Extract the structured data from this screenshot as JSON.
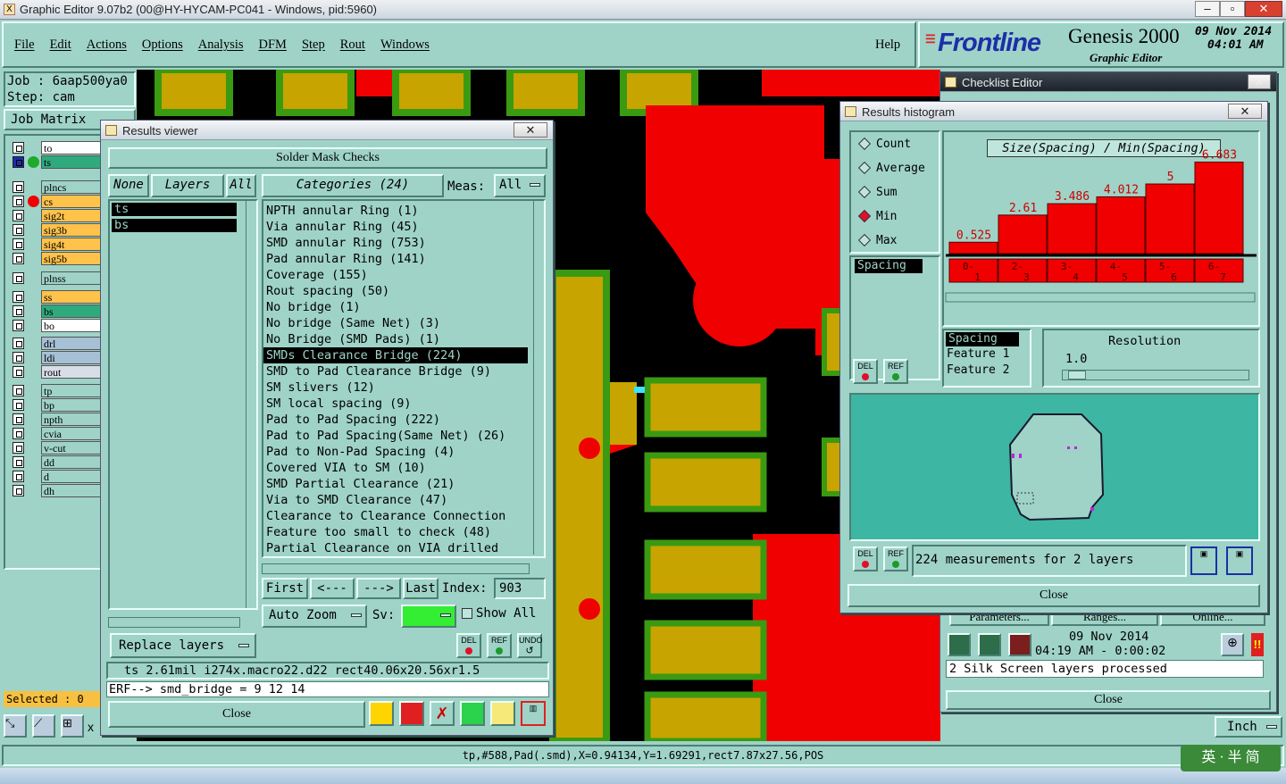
{
  "title_bar": {
    "text": "Graphic Editor 9.07b2 (00@HY-HYCAM-PC041 - Windows, pid:5960)"
  },
  "menu": {
    "items": [
      "File",
      "Edit",
      "Actions",
      "Options",
      "Analysis",
      "DFM",
      "Step",
      "Rout",
      "Windows"
    ],
    "help": "Help"
  },
  "brand": {
    "logo": "Frontline",
    "product": "Genesis 2000",
    "subtitle": "Graphic Editor",
    "date": "09 Nov 2014",
    "time": "04:01 AM"
  },
  "job": {
    "job_line": "Job : 6aap500ya0",
    "step_line": "Step: cam",
    "matrix_label": "Job Matrix"
  },
  "layers": [
    {
      "name": "to",
      "color": "#ffffff",
      "dot": ""
    },
    {
      "name": "ts",
      "color": "#2faa7d",
      "dot": "#1faa2a"
    },
    {
      "name": "plncs",
      "color": "#9fd3c7",
      "dot": ""
    },
    {
      "name": "cs",
      "color": "#ffc24a",
      "dot": "#f00000"
    },
    {
      "name": "sig2t",
      "color": "#ffc24a",
      "dot": ""
    },
    {
      "name": "sig3b",
      "color": "#ffc24a",
      "dot": ""
    },
    {
      "name": "sig4t",
      "color": "#ffc24a",
      "dot": ""
    },
    {
      "name": "sig5b",
      "color": "#ffc24a",
      "dot": ""
    },
    {
      "name": "plnss",
      "color": "#9fd3c7",
      "dot": ""
    },
    {
      "name": "ss",
      "color": "#ffc24a",
      "dot": ""
    },
    {
      "name": "bs",
      "color": "#2faa7d",
      "dot": ""
    },
    {
      "name": "bo",
      "color": "#ffffff",
      "dot": ""
    },
    {
      "name": "drl",
      "color": "#a6c0d6",
      "dot": ""
    },
    {
      "name": "ldi",
      "color": "#a6c0d6",
      "dot": ""
    },
    {
      "name": "rout",
      "color": "#d8dde8",
      "dot": ""
    },
    {
      "name": "tp",
      "color": "#9fd3c7",
      "dot": ""
    },
    {
      "name": "bp",
      "color": "#9fd3c7",
      "dot": ""
    },
    {
      "name": "npth",
      "color": "#9fd3c7",
      "dot": ""
    },
    {
      "name": "cvia",
      "color": "#9fd3c7",
      "dot": ""
    },
    {
      "name": "v-cut",
      "color": "#9fd3c7",
      "dot": ""
    },
    {
      "name": "dd",
      "color": "#9fd3c7",
      "dot": ""
    },
    {
      "name": "d",
      "color": "#9fd3c7",
      "dot": ""
    },
    {
      "name": "dh",
      "color": "#9fd3c7",
      "dot": ""
    }
  ],
  "selected_label": "Selected : 0",
  "results_viewer": {
    "title": "Results viewer",
    "header": "Solder Mask Checks",
    "none_btn": "None",
    "layers_btn": "Layers",
    "all_btn": "All",
    "categories_btn": "Categories (24)",
    "meas_label": "Meas:",
    "meas_value": "All",
    "layer_list": [
      "ts",
      "bs"
    ],
    "categories": [
      "NPTH annular Ring (1)",
      "Via annular Ring (45)",
      "SMD annular Ring (753)",
      "Pad annular Ring (141)",
      "Coverage (155)",
      "Rout spacing (50)",
      "No bridge (1)",
      "No bridge (Same Net) (3)",
      "No Bridge (SMD Pads) (1)",
      "SMDs Clearance Bridge (224)",
      "SMD to Pad Clearance Bridge (9)",
      "SM slivers (12)",
      "SM local spacing (9)",
      "Pad to Pad Spacing (222)",
      "Pad to Pad Spacing(Same Net) (26)",
      "Pad to Non-Pad Spacing (4)",
      "Covered VIA to SM (10)",
      "SMD Partial Clearance (21)",
      "Via to SMD Clearance (47)",
      "Clearance to Clearance Connection",
      "Feature too small to check (48)",
      "Partial Clearance on VIA drilled"
    ],
    "selected_index": 9,
    "nav": {
      "first": "First",
      "prev": "<---",
      "next": "--->",
      "last": "Last",
      "index_label": "Index:",
      "index_value": "903"
    },
    "auto_zoom": "Auto Zoom",
    "sv_label": "Sv:",
    "show_all": "Show All",
    "replace_layers": "Replace layers",
    "del": "DEL",
    "ref": "REF",
    "undo": "UNDO",
    "info_line": "ts 2.61mil   i274x.macro22.d22   rect40.06x20.56xr1.5",
    "erf_line": "ERF--> smd_bridge = 9 12 14",
    "close": "Close"
  },
  "checklist_editor": {
    "title": "Checklist Editor",
    "tabs": [
      "Parameters...",
      "Ranges...",
      "Online..."
    ],
    "date": "09 Nov 2014",
    "time_line": "04:19 AM - 0:00:02",
    "status": "2 Silk Screen layers processed",
    "close": "Close"
  },
  "histogram": {
    "title": "Results histogram",
    "options": [
      "Count",
      "Average",
      "Sum",
      "Min",
      "Max"
    ],
    "selected_option": "Min",
    "measure_list": [
      "Spacing"
    ],
    "chart_title": "Size(Spacing) / Min(Spacing)",
    "bins": [
      "0-1",
      "2-3",
      "3-4",
      "4-5",
      "5-6",
      "6-7"
    ],
    "values": [
      0.525,
      2.61,
      3.486,
      4.012,
      5,
      6.683
    ],
    "value_labels": [
      "0.525",
      "2.61",
      "3.486",
      "4.012",
      "5",
      "6.683"
    ],
    "spacing_list": [
      "Spacing",
      "Feature 1",
      "Feature 2"
    ],
    "resolution_label": "Resolution",
    "resolution_value": "1.0",
    "del": "DEL",
    "ref": "REF",
    "summary": "224 measurements for 2 layers",
    "close": "Close"
  },
  "units": "Inch",
  "status_bar": "tp,#588,Pad(.smd),X=0.94134,Y=1.69291,rect7.87x27.56,POS",
  "ime": "英 · 半 简",
  "colors": {
    "panel": "#9fd3c7",
    "copper": "#c8a400",
    "mask": "#f00000",
    "background": "#000000"
  }
}
